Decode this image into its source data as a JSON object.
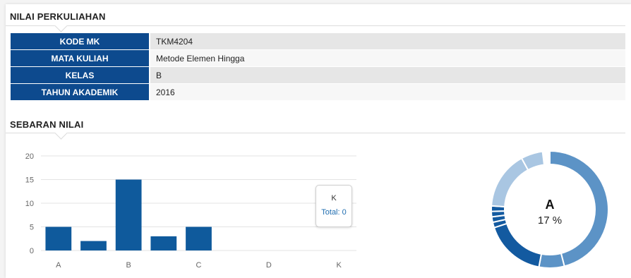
{
  "title_nilai": "NILAI PERKULIAHAN",
  "info_rows": [
    {
      "key": "KODE MK",
      "value": "TKM4204"
    },
    {
      "key": "MATA KULIAH",
      "value": "Metode Elemen Hingga"
    },
    {
      "key": "KELAS",
      "value": "B"
    },
    {
      "key": "TAHUN AKADEMIK",
      "value": "2016"
    }
  ],
  "title_sebaran": "SEBARAN NILAI",
  "colors": {
    "header_bg": "#0d4a8e",
    "bar": "#0f5a9c",
    "donut_dark": "#135aa0",
    "donut_mid": "#5c93c6",
    "donut_light": "#a9c6e2"
  },
  "chart_data": [
    {
      "type": "bar",
      "x_ticks": [
        "A",
        "B",
        "C",
        "D",
        "K"
      ],
      "values": [
        5,
        2,
        15,
        3,
        5,
        0,
        0,
        0,
        0
      ],
      "ylim": [
        0,
        20
      ],
      "yticks": [
        0,
        5,
        10,
        15,
        20
      ],
      "grid": true,
      "tooltip": {
        "label": "K",
        "total_text": "Total: 0"
      }
    },
    {
      "type": "pie",
      "center_label": "A",
      "center_value": "17 %",
      "slices": [
        {
          "shade": "mid",
          "fraction": 0.46
        },
        {
          "shade": "mid",
          "fraction": 0.07
        },
        {
          "shade": "dark",
          "fraction": 0.17
        },
        {
          "shade": "dark",
          "fraction": 0.015
        },
        {
          "shade": "dark",
          "fraction": 0.015
        },
        {
          "shade": "dark",
          "fraction": 0.015
        },
        {
          "shade": "dark",
          "fraction": 0.015
        },
        {
          "shade": "light",
          "fraction": 0.16
        },
        {
          "shade": "light",
          "fraction": 0.06
        }
      ]
    }
  ]
}
